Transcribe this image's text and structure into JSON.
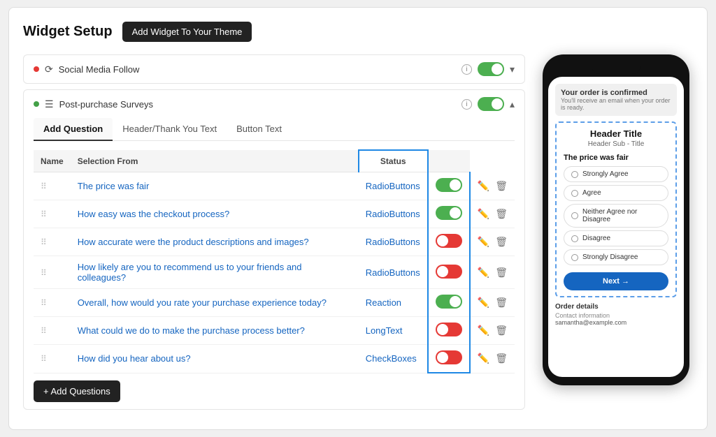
{
  "page": {
    "title": "Widget Setup",
    "add_widget_btn": "Add Widget To Your Theme"
  },
  "widgets": [
    {
      "dot_color": "red",
      "label": "Social Media Follow",
      "toggle_state": "on",
      "chevron": "▼",
      "expanded": false
    },
    {
      "dot_color": "green",
      "label": "Post-purchase Surveys",
      "toggle_state": "on",
      "chevron": "▲",
      "expanded": true
    }
  ],
  "survey": {
    "tabs": [
      {
        "label": "Add Question",
        "active": true
      },
      {
        "label": "Header/Thank You Text",
        "active": false
      },
      {
        "label": "Button Text",
        "active": false
      }
    ],
    "table": {
      "headers": [
        "Name",
        "Selection From",
        "Status"
      ],
      "rows": [
        {
          "name": "The price was fair",
          "selection": "RadioButtons",
          "status": "on"
        },
        {
          "name": "How easy was the checkout process?",
          "selection": "RadioButtons",
          "status": "on"
        },
        {
          "name": "How accurate were the product descriptions and images?",
          "selection": "RadioButtons",
          "status": "off"
        },
        {
          "name": "How likely are you to recommend us to your friends and colleagues?",
          "selection": "RadioButtons",
          "status": "off"
        },
        {
          "name": "Overall, how would you rate your purchase experience today?",
          "selection": "Reaction",
          "status": "on"
        },
        {
          "name": "What could we do to make the purchase process better?",
          "selection": "LongText",
          "status": "off"
        },
        {
          "name": "How did you hear about us?",
          "selection": "CheckBoxes",
          "status": "off"
        }
      ]
    },
    "add_questions_btn": "+ Add Questions"
  },
  "phone_preview": {
    "order_confirmed": "Your order is confirmed",
    "order_confirmed_sub": "You'll receive an email when your order is ready.",
    "survey_header_title": "Header Title",
    "survey_header_sub": "Header Sub - Title",
    "question": "The price was fair",
    "options": [
      "Strongly Agree",
      "Agree",
      "Neither Agree nor Disagree",
      "Disagree",
      "Strongly Disagree"
    ],
    "next_btn": "Next →",
    "order_details_title": "Order details",
    "contact_label": "Contact information",
    "contact_value": "samantha@example.com"
  }
}
